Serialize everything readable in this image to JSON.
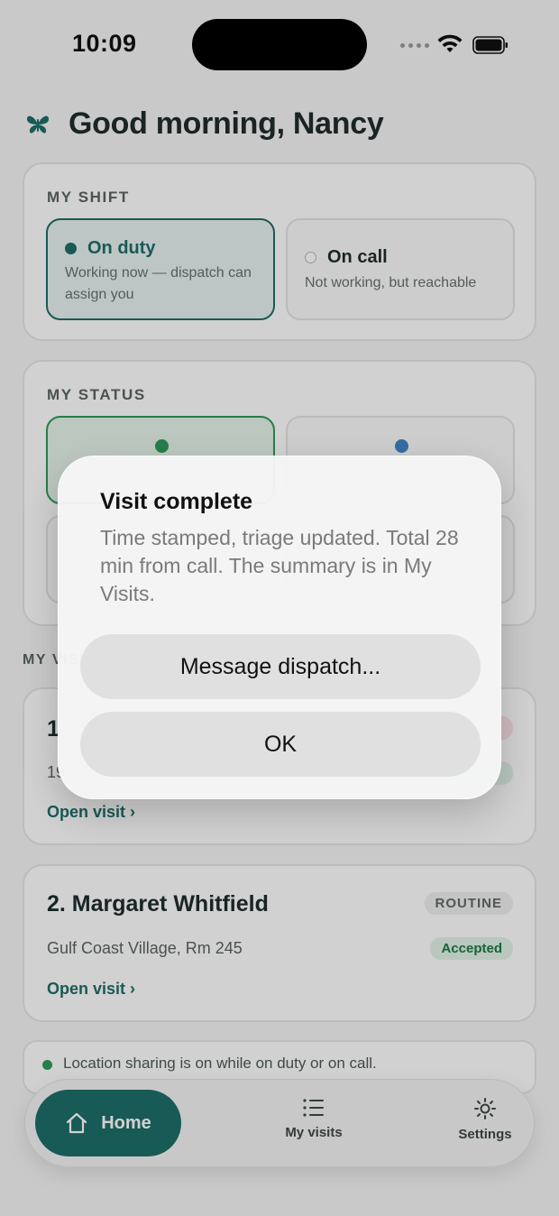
{
  "status_bar": {
    "time": "10:09"
  },
  "greeting": "Good morning, Nancy",
  "shift": {
    "title": "MY SHIFT",
    "options": [
      {
        "label": "On duty",
        "description": "Working now — dispatch can assign you",
        "selected": true,
        "dot_color": "#1e6e68"
      },
      {
        "label": "On call",
        "description": "Not working, but reachable",
        "selected": false
      }
    ]
  },
  "status": {
    "title": "MY STATUS",
    "tiles": [
      {
        "dot_color": "#2f9a5a",
        "selected": true
      },
      {
        "dot_color": "#3f86c8",
        "selected": false
      }
    ]
  },
  "visits": {
    "section_label": "MY VISITS",
    "items": [
      {
        "number_title": "1",
        "address": "19",
        "link": "Open visit ›"
      },
      {
        "number_title": "2. Margaret Whitfield",
        "address": "Gulf Coast Village, Rm 245",
        "priority": "ROUTINE",
        "state": "Accepted",
        "link": "Open visit ›"
      }
    ]
  },
  "location_notice": "Location sharing is on while on duty or on call.",
  "tabbar": {
    "home": "Home",
    "visits": "My visits",
    "settings": "Settings"
  },
  "alert": {
    "title": "Visit complete",
    "message": "Time stamped, triage updated. Total 28 min from call. The summary is in My Visits.",
    "primary_button": "Message dispatch...",
    "ok_button": "OK"
  },
  "colors": {
    "accent": "#1e6e68",
    "background": "#f6f6f6"
  }
}
